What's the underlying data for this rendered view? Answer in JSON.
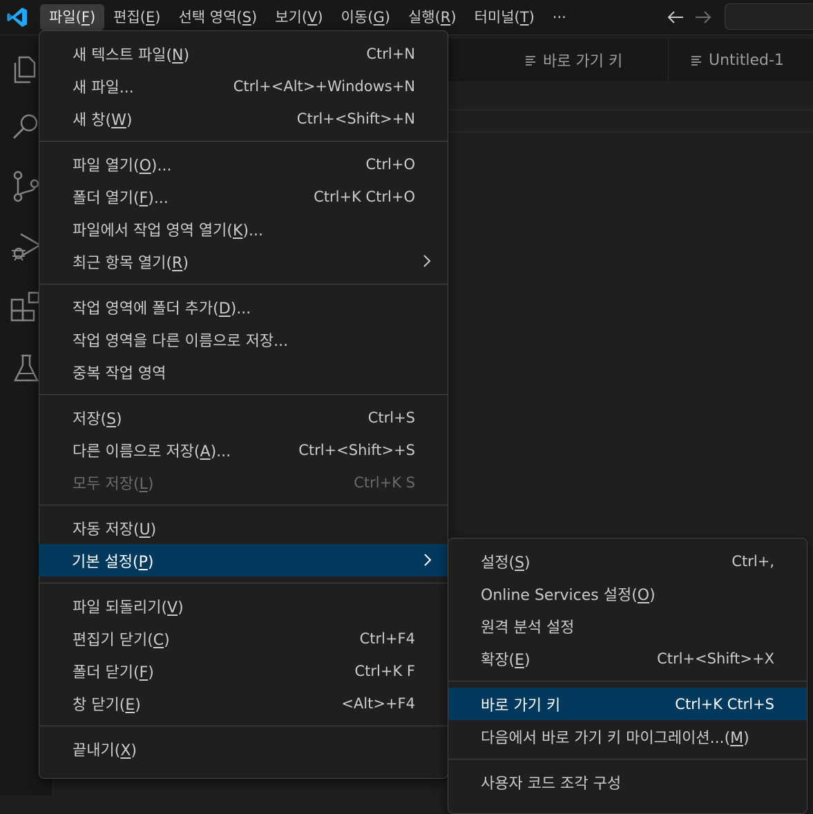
{
  "titlebar": {
    "menus": [
      {
        "label": "파일",
        "mnemonic": "F",
        "active": true
      },
      {
        "label": "편집",
        "mnemonic": "E"
      },
      {
        "label": "선택 영역",
        "mnemonic": "S"
      },
      {
        "label": "보기",
        "mnemonic": "V"
      },
      {
        "label": "이동",
        "mnemonic": "G"
      },
      {
        "label": "실행",
        "mnemonic": "R"
      },
      {
        "label": "터미널",
        "mnemonic": "T"
      }
    ],
    "more": "···",
    "back_icon": "arrow-left-icon",
    "forward_icon": "arrow-right-icon"
  },
  "activitybar": [
    "explorer-icon",
    "search-icon",
    "source-control-icon",
    "run-debug-icon",
    "extensions-icon",
    "testing-icon"
  ],
  "tabs": [
    {
      "label": "바로 가기 키",
      "icon": "list-icon"
    },
    {
      "label": "Untitled-1",
      "icon": "list-icon"
    }
  ],
  "file_menu": {
    "groups": [
      [
        {
          "label": "새 텍스트 파일",
          "mn": "N",
          "suffix": "",
          "kb": "Ctrl+N"
        },
        {
          "label": "새 파일...",
          "mn": "",
          "suffix": "",
          "kb": "Ctrl+<Alt>+Windows+N"
        },
        {
          "label": "새 창",
          "mn": "W",
          "suffix": "",
          "kb": "Ctrl+<Shift>+N"
        }
      ],
      [
        {
          "label": "파일 열기",
          "mn": "O",
          "suffix": "...",
          "kb": "Ctrl+O"
        },
        {
          "label": "폴더 열기",
          "mn": "F",
          "suffix": "...",
          "kb": "Ctrl+K Ctrl+O"
        },
        {
          "label": "파일에서 작업 영역 열기",
          "mn": "K",
          "suffix": "...",
          "kb": ""
        },
        {
          "label": "최근 항목 열기",
          "mn": "R",
          "suffix": "",
          "kb": "",
          "submenu": true
        }
      ],
      [
        {
          "label": "작업 영역에 폴더 추가",
          "mn": "D",
          "suffix": "...",
          "kb": ""
        },
        {
          "label": "작업 영역을 다른 이름으로 저장...",
          "mn": "",
          "suffix": "",
          "kb": ""
        },
        {
          "label": "중복 작업 영역",
          "mn": "",
          "suffix": "",
          "kb": ""
        }
      ],
      [
        {
          "label": "저장",
          "mn": "S",
          "suffix": "",
          "kb": "Ctrl+S"
        },
        {
          "label": "다른 이름으로 저장",
          "mn": "A",
          "suffix": "...",
          "kb": "Ctrl+<Shift>+S"
        },
        {
          "label": "모두 저장",
          "mn": "L",
          "suffix": "",
          "kb": "Ctrl+K S",
          "disabled": true
        }
      ],
      [
        {
          "label": "자동 저장",
          "mn": "U",
          "suffix": "",
          "kb": ""
        },
        {
          "label": "기본 설정",
          "mn": "P",
          "suffix": "",
          "kb": "",
          "submenu": true,
          "highlighted": true
        }
      ],
      [
        {
          "label": "파일 되돌리기",
          "mn": "V",
          "suffix": "",
          "kb": ""
        },
        {
          "label": "편집기 닫기",
          "mn": "C",
          "suffix": "",
          "kb": "Ctrl+F4"
        },
        {
          "label": "폴더 닫기",
          "mn": "F",
          "suffix": "",
          "kb": "Ctrl+K F"
        },
        {
          "label": "창 닫기",
          "mn": "E",
          "suffix": "",
          "kb": "<Alt>+F4"
        }
      ],
      [
        {
          "label": "끝내기",
          "mn": "X",
          "suffix": "",
          "kb": ""
        }
      ]
    ]
  },
  "preferences_menu": {
    "groups": [
      [
        {
          "label": "설정",
          "mn": "S",
          "suffix": "",
          "kb": "Ctrl+,"
        },
        {
          "label": "Online Services 설정",
          "mn": "O",
          "suffix": "",
          "kb": ""
        },
        {
          "label": "원격 분석 설정",
          "mn": "",
          "suffix": "",
          "kb": ""
        },
        {
          "label": "확장",
          "mn": "E",
          "suffix": "",
          "kb": "Ctrl+<Shift>+X"
        }
      ],
      [
        {
          "label": "바로 가기 키",
          "mn": "",
          "suffix": "",
          "kb": "Ctrl+K Ctrl+S",
          "highlighted": true
        },
        {
          "label": "다음에서 바로 가기 키 마이그레이션...",
          "mn": "M",
          "suffix": "",
          "kb": ""
        }
      ],
      [
        {
          "label": "사용자 코드 조각 구성",
          "mn": "",
          "suffix": "",
          "kb": ""
        }
      ]
    ]
  },
  "colors": {
    "accent": "#0078d4",
    "selection": "#04395e",
    "background": "#1f1f1f",
    "vscode_blue": "#23a8f2"
  }
}
